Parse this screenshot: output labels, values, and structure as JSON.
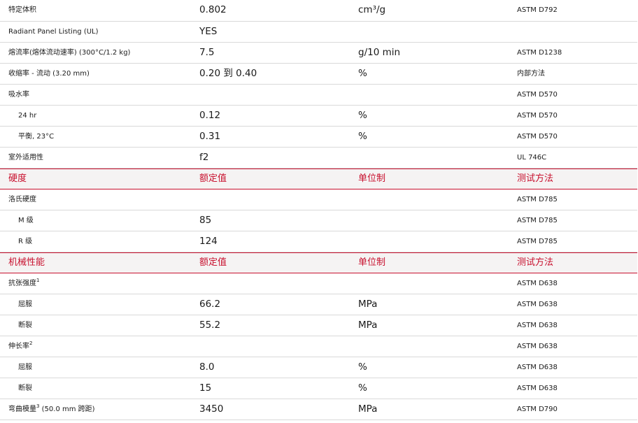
{
  "rows": [
    {
      "kind": "data",
      "property": "特定体积",
      "sup": "",
      "indent": false,
      "value": "0.802",
      "unit": "cm³/g",
      "method": "ASTM D792"
    },
    {
      "kind": "data",
      "property": "Radiant Panel Listing (UL)",
      "sup": "",
      "indent": false,
      "value": "YES",
      "unit": "",
      "method": ""
    },
    {
      "kind": "data",
      "property": "熔流率(熔体流动速率) (300°C/1.2 kg)",
      "sup": "",
      "indent": false,
      "value": "7.5",
      "unit": "g/10 min",
      "method": "ASTM D1238"
    },
    {
      "kind": "data",
      "property": "收缩率 - 流动 (3.20 mm)",
      "sup": "",
      "indent": false,
      "value": "0.20 到 0.40",
      "unit": "%",
      "method": "内部方法"
    },
    {
      "kind": "data",
      "property": "吸水率",
      "sup": "",
      "indent": false,
      "value": "",
      "unit": "",
      "method": "ASTM D570"
    },
    {
      "kind": "data",
      "property": "24 hr",
      "sup": "",
      "indent": true,
      "value": "0.12",
      "unit": "%",
      "method": "ASTM D570"
    },
    {
      "kind": "data",
      "property": "平衡, 23°C",
      "sup": "",
      "indent": true,
      "value": "0.31",
      "unit": "%",
      "method": "ASTM D570"
    },
    {
      "kind": "data",
      "property": "室外适用性",
      "sup": "",
      "indent": false,
      "value": "f2",
      "unit": "",
      "method": "UL 746C"
    },
    {
      "kind": "header",
      "property": "硬度",
      "value": "额定值",
      "unit": "单位制",
      "method": "测试方法"
    },
    {
      "kind": "data",
      "property": "洛氏硬度",
      "sup": "",
      "indent": false,
      "value": "",
      "unit": "",
      "method": "ASTM D785"
    },
    {
      "kind": "data",
      "property": "M 级",
      "sup": "",
      "indent": true,
      "value": "85",
      "unit": "",
      "method": "ASTM D785"
    },
    {
      "kind": "data",
      "property": "R 级",
      "sup": "",
      "indent": true,
      "value": "124",
      "unit": "",
      "method": "ASTM D785"
    },
    {
      "kind": "header",
      "property": "机械性能",
      "value": "额定值",
      "unit": "单位制",
      "method": "测试方法"
    },
    {
      "kind": "data",
      "property": "抗张强度",
      "sup": "1",
      "indent": false,
      "value": "",
      "unit": "",
      "method": "ASTM D638"
    },
    {
      "kind": "data",
      "property": "屈服",
      "sup": "",
      "indent": true,
      "value": "66.2",
      "unit": "MPa",
      "method": "ASTM D638"
    },
    {
      "kind": "data",
      "property": "断裂",
      "sup": "",
      "indent": true,
      "value": "55.2",
      "unit": "MPa",
      "method": "ASTM D638"
    },
    {
      "kind": "data",
      "property": "伸长率",
      "sup": "2",
      "indent": false,
      "value": "",
      "unit": "",
      "method": "ASTM D638"
    },
    {
      "kind": "data",
      "property": "屈服",
      "sup": "",
      "indent": true,
      "value": "8.0",
      "unit": "%",
      "method": "ASTM D638"
    },
    {
      "kind": "data",
      "property": "断裂",
      "sup": "",
      "indent": true,
      "value": "15",
      "unit": "%",
      "method": "ASTM D638"
    },
    {
      "kind": "data",
      "property": "弯曲模量",
      "sup": "3",
      "suffix": " (50.0 mm 跨距)",
      "indent": false,
      "value": "3450",
      "unit": "MPa",
      "method": "ASTM D790"
    }
  ],
  "colors": {
    "section_header_text": "#c8102e",
    "section_header_rule": "#c8102e",
    "section_header_bg": "#f5f3f3",
    "row_divider": "#d9d9d9",
    "body_text": "#1a1a1a"
  }
}
